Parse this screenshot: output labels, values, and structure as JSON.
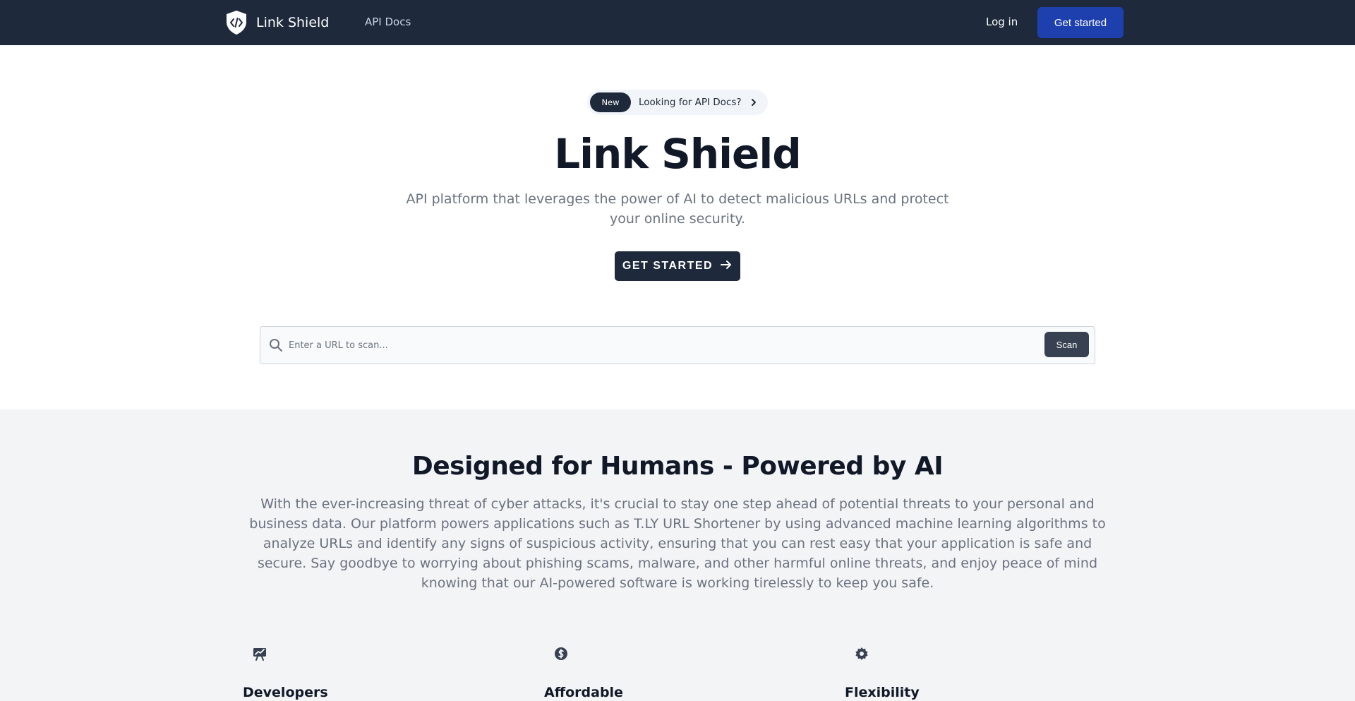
{
  "nav": {
    "brand": "Link Shield",
    "links": [
      {
        "label": "API Docs"
      }
    ],
    "login": "Log in",
    "cta": "Get started"
  },
  "hero": {
    "badge": "New",
    "pill_text": "Looking for API Docs?",
    "title": "Link Shield",
    "subtitle": "API platform that leverages the power of AI to detect malicious URLs and protect your online security.",
    "cta": "GET STARTED"
  },
  "scan": {
    "placeholder": "Enter a URL to scan...",
    "value": "",
    "button": "Scan"
  },
  "features": {
    "title": "Designed for Humans - Powered by AI",
    "body": "With the ever-increasing threat of cyber attacks, it's crucial to stay one step ahead of potential threats to your personal and business data. Our platform powers applications such as T.LY URL Shortener by using advanced machine learning algorithms to analyze URLs and identify any signs of suspicious activity, ensuring that you can rest easy that your application is safe and secure. Say goodbye to worrying about phishing scams, malware, and other harmful online threats, and enjoy peace of mind knowing that our AI-powered software is working tirelessly to keep you safe.",
    "items": [
      {
        "title": "Developers",
        "icon": "presentation-chart-icon"
      },
      {
        "title": "Affordable",
        "icon": "dollar-coin-icon"
      },
      {
        "title": "Flexibility",
        "icon": "gear-icon"
      }
    ]
  },
  "colors": {
    "nav_bg": "#1e293b",
    "primary": "#1e40af",
    "dark_button": "#1e293b",
    "section_bg": "#f3f4f6"
  }
}
